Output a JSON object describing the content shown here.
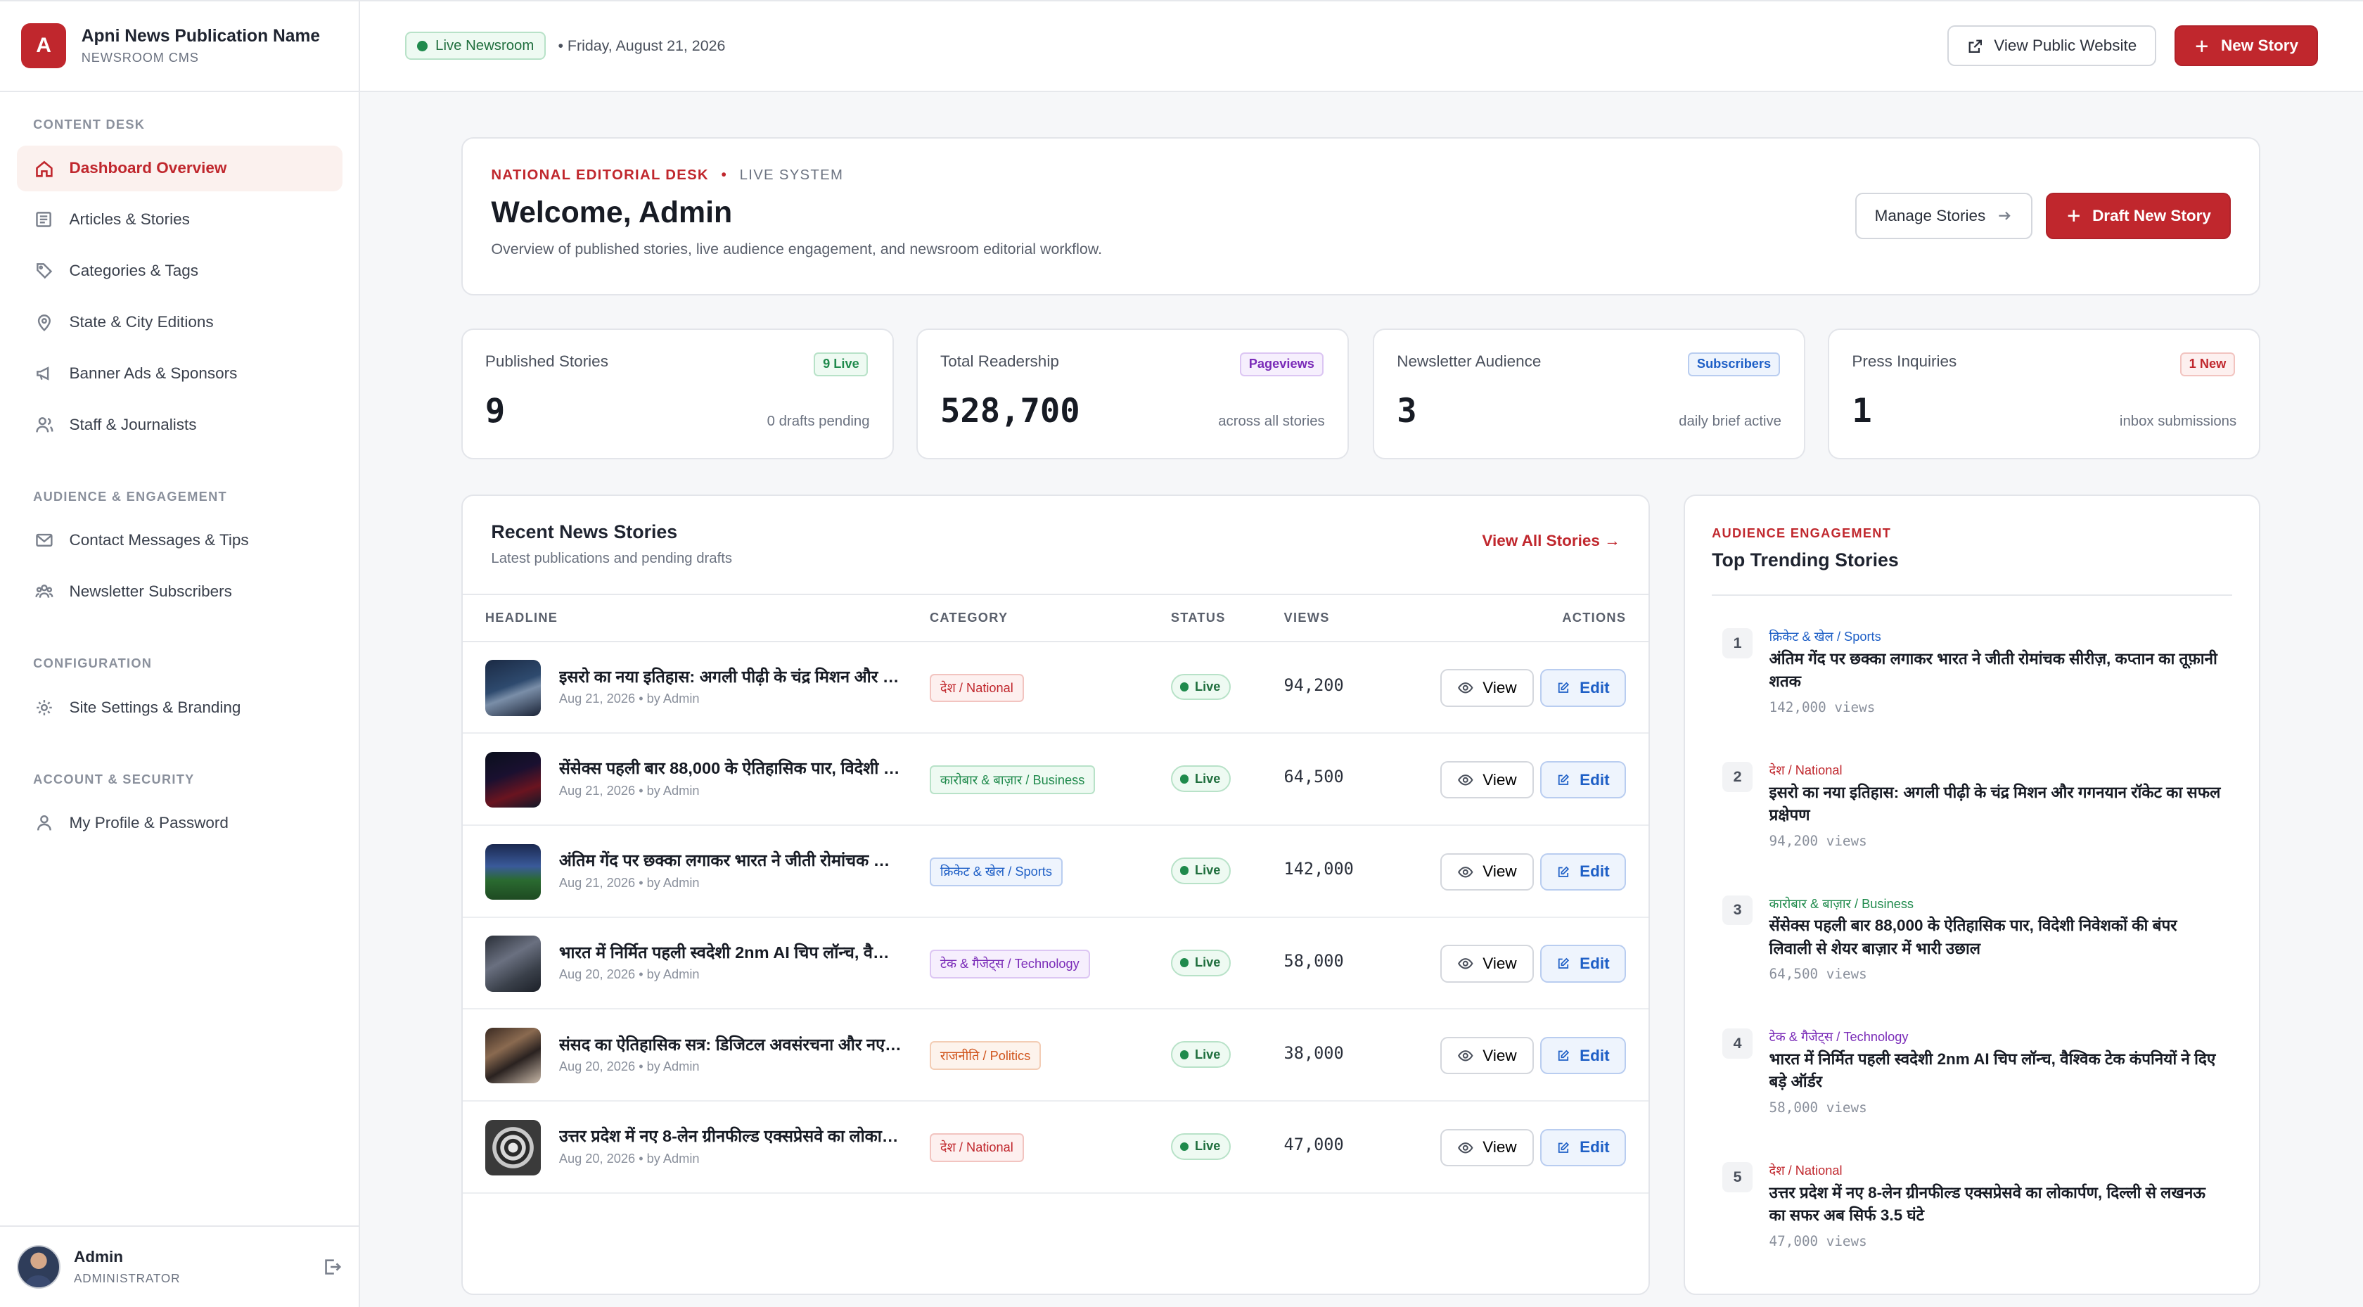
{
  "brand": {
    "logo_letter": "A",
    "name": "Apni News Publication Name",
    "subtitle": "NEWSROOM CMS"
  },
  "sidebar": {
    "sections": [
      {
        "title": "CONTENT DESK",
        "items": [
          {
            "label": "Dashboard Overview",
            "icon": "home-icon",
            "active": true
          },
          {
            "label": "Articles & Stories",
            "icon": "newspaper-icon"
          },
          {
            "label": "Categories & Tags",
            "icon": "tag-icon"
          },
          {
            "label": "State & City Editions",
            "icon": "map-pin-icon"
          },
          {
            "label": "Banner Ads & Sponsors",
            "icon": "megaphone-icon"
          },
          {
            "label": "Staff & Journalists",
            "icon": "users-icon"
          }
        ]
      },
      {
        "title": "AUDIENCE & ENGAGEMENT",
        "items": [
          {
            "label": "Contact Messages & Tips",
            "icon": "mail-icon"
          },
          {
            "label": "Newsletter Subscribers",
            "icon": "group-icon"
          }
        ]
      },
      {
        "title": "CONFIGURATION",
        "items": [
          {
            "label": "Site Settings & Branding",
            "icon": "gear-icon"
          }
        ]
      },
      {
        "title": "ACCOUNT & SECURITY",
        "items": [
          {
            "label": "My Profile & Password",
            "icon": "user-icon"
          }
        ]
      }
    ],
    "user": {
      "name": "Admin",
      "role": "ADMINISTRATOR"
    }
  },
  "topbar": {
    "live_label": "Live Newsroom",
    "date": "• Friday, August 21, 2026",
    "view_site_label": "View Public Website",
    "new_story_label": "New Story"
  },
  "welcome": {
    "eyebrow_desk": "NATIONAL EDITORIAL DESK",
    "eyebrow_sep": "•",
    "eyebrow_system": "LIVE SYSTEM",
    "title": "Welcome, Admin",
    "description": "Overview of published stories, live audience engagement, and newsroom editorial workflow.",
    "manage_label": "Manage Stories",
    "draft_label": "Draft New Story"
  },
  "stats": [
    {
      "label": "Published Stories",
      "badge": "9 Live",
      "value": "9",
      "note": "0 drafts pending",
      "badge_color": "#1f8a4c",
      "badge_bg": "#eefaf2",
      "badge_border": "#b8e2c8"
    },
    {
      "label": "Total Readership",
      "badge": "Pageviews",
      "value": "528,700",
      "note": "across all stories",
      "badge_color": "#7a2bb8",
      "badge_bg": "#f6effd",
      "badge_border": "#dcc6f3"
    },
    {
      "label": "Newsletter Audience",
      "badge": "Subscribers",
      "value": "3",
      "note": "daily brief active",
      "badge_color": "#1e5fc6",
      "badge_bg": "#eef4fd",
      "badge_border": "#b9cdf0"
    },
    {
      "label": "Press Inquiries",
      "badge": "1 New",
      "value": "1",
      "note": "inbox submissions",
      "badge_color": "#c0272d",
      "badge_bg": "#fdf0ef",
      "badge_border": "#f2c4c0"
    }
  ],
  "recent": {
    "title": "Recent News Stories",
    "subtitle": "Latest publications and pending drafts",
    "view_all_label": "View All Stories →",
    "columns": {
      "headline": "HEADLINE",
      "category": "CATEGORY",
      "status": "STATUS",
      "views": "VIEWS",
      "actions": "ACTIONS"
    },
    "view_label": "View",
    "edit_label": "Edit",
    "rows": [
      {
        "headline": "इसरो का नया इतिहास: अगली पीढ़ी के चंद्र मिशन और गगनयान रॉकेट का सफल प्रक्षेपण",
        "byline": "Aug 21, 2026 • by Admin",
        "category": "देश / National",
        "cat_color": "#c0272d",
        "cat_bg": "#fdf0ef",
        "cat_border": "#f2c4c0",
        "status": "Live",
        "views": "94,200",
        "thumb": "rocket"
      },
      {
        "headline": "सेंसेक्स पहली बार 88,000 के ऐतिहासिक पार, विदेशी निवेशकों की बंपर लिवाली से शेयर बाज़ार में भारी उछाल",
        "byline": "Aug 21, 2026 • by Admin",
        "category": "कारोबार & बाज़ार / Business",
        "cat_color": "#1f8a4c",
        "cat_bg": "#eefaf2",
        "cat_border": "#b8e2c8",
        "status": "Live",
        "views": "64,500",
        "thumb": "market"
      },
      {
        "headline": "अंतिम गेंद पर छक्का लगाकर भारत ने जीती रोमांचक सीरीज़, कप्तान का तूफ़ानी शतक",
        "byline": "Aug 21, 2026 • by Admin",
        "category": "क्रिकेट & खेल / Sports",
        "cat_color": "#1e5fc6",
        "cat_bg": "#eef4fd",
        "cat_border": "#b9cdf0",
        "status": "Live",
        "views": "142,000",
        "thumb": "stadium"
      },
      {
        "headline": "भारत में निर्मित पहली स्वदेशी 2nm AI चिप लॉन्च, वैश्विक टेक कंपनियों ने दिए बड़े ऑर्डर",
        "byline": "Aug 20, 2026 • by Admin",
        "category": "टेक & गैजेट्स / Technology",
        "cat_color": "#7a2bb8",
        "cat_bg": "#f6effd",
        "cat_border": "#dcc6f3",
        "status": "Live",
        "views": "58,000",
        "thumb": "chip"
      },
      {
        "headline": "संसद का ऐतिहासिक सत्र: डिजिटल अवसंरचना और नए विधेयकों पर चर्चा",
        "byline": "Aug 20, 2026 • by Admin",
        "category": "राजनीति / Politics",
        "cat_color": "#d0541c",
        "cat_bg": "#fdf3ec",
        "cat_border": "#f3cdb5",
        "status": "Live",
        "views": "38,000",
        "thumb": "politics"
      },
      {
        "headline": "उत्तर प्रदेश में नए 8-लेन ग्रीनफील्ड एक्सप्रेसवे का लोकार्पण, दिल्ली से लखनऊ का सफर अब सिर्फ 3.5 घंटे",
        "byline": "Aug 20, 2026 • by Admin",
        "category": "देश / National",
        "cat_color": "#c0272d",
        "cat_bg": "#fdf0ef",
        "cat_border": "#f2c4c0",
        "status": "Live",
        "views": "47,000",
        "thumb": "road"
      }
    ]
  },
  "trending": {
    "eyebrow": "AUDIENCE ENGAGEMENT",
    "title": "Top Trending Stories",
    "items": [
      {
        "rank": "1",
        "category": "क्रिकेट & खेल / Sports",
        "cat_color": "#1e5fc6",
        "headline": "अंतिम गेंद पर छक्का लगाकर भारत ने जीती रोमांचक सीरीज़, कप्तान का तूफ़ानी शतक",
        "views": "142,000 views"
      },
      {
        "rank": "2",
        "category": "देश / National",
        "cat_color": "#c0272d",
        "headline": "इसरो का नया इतिहास: अगली पीढ़ी के चंद्र मिशन और गगनयान रॉकेट का सफल प्रक्षेपण",
        "views": "94,200 views"
      },
      {
        "rank": "3",
        "category": "कारोबार & बाज़ार / Business",
        "cat_color": "#1f8a4c",
        "headline": "सेंसेक्स पहली बार 88,000 के ऐतिहासिक पार, विदेशी निवेशकों की बंपर लिवाली से शेयर बाज़ार में भारी उछाल",
        "views": "64,500 views"
      },
      {
        "rank": "4",
        "category": "टेक & गैजेट्स / Technology",
        "cat_color": "#7a2bb8",
        "headline": "भारत में निर्मित पहली स्वदेशी 2nm AI चिप लॉन्च, वैश्विक टेक कंपनियों ने दिए बड़े ऑर्डर",
        "views": "58,000 views"
      },
      {
        "rank": "5",
        "category": "देश / National",
        "cat_color": "#c0272d",
        "headline": "उत्तर प्रदेश में नए 8-लेन ग्रीनफील्ड एक्सप्रेसवे का लोकार्पण, दिल्ली से लखनऊ का सफर अब सिर्फ 3.5 घंटे",
        "views": "47,000 views"
      }
    ]
  }
}
